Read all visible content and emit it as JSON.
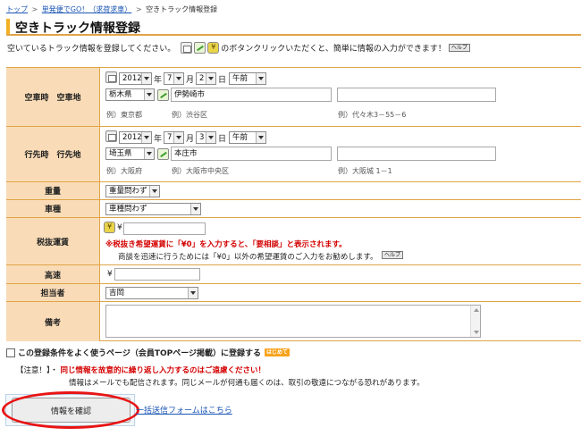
{
  "breadcrumb": {
    "home": "トップ",
    "parent": "単発便でGO！（求荷求車）",
    "current": "空きトラック情報登録",
    "sep": ">"
  },
  "page": {
    "title": "空きトラック情報登録",
    "intro_pre": "空いているトラック情報を登録してください。",
    "intro_post": "のボタンクリックいただくと、簡単に情報の入力ができます！",
    "help_label": "ヘルプ"
  },
  "departure": {
    "label": "空車時　空車地",
    "year": "2012",
    "year_unit": "年",
    "month": "7",
    "month_unit": "月",
    "day": "2",
    "day_unit": "日",
    "ampm": "午前",
    "pref": "栃木県",
    "city": "伊勢崎市",
    "address": "",
    "ex_pref": "例）東京都",
    "ex_city": "例）渋谷区",
    "ex_address": "例）代々木3－55－6"
  },
  "destination": {
    "label": "行先時　行先地",
    "year": "2012",
    "year_unit": "年",
    "month": "7",
    "month_unit": "月",
    "day": "3",
    "day_unit": "日",
    "ampm": "午前",
    "pref": "埼玉県",
    "city": "本庄市",
    "address": "",
    "ex_pref": "例）大阪府",
    "ex_city": "例）大阪市中央区",
    "ex_address": "例）大阪城 1－1"
  },
  "weight": {
    "label": "重量",
    "value": "重量問わず"
  },
  "vehicle": {
    "label": "車種",
    "value": "車種問わず"
  },
  "fare": {
    "label": "税抜運賃",
    "currency": "¥",
    "value": "",
    "warning": "※税抜き希望運賃に「¥0」を入力すると、「要相談」と表示されます。",
    "note": "商談を迅速に行うためには「¥0」以外の希望運賃のご入力をお勧めします。",
    "help_label": "ヘルプ"
  },
  "highway": {
    "label": "高速",
    "currency": "¥",
    "value": ""
  },
  "staff": {
    "label": "担当者",
    "value": "吉岡"
  },
  "remarks": {
    "label": "備考",
    "value": ""
  },
  "save_condition": {
    "label": "この登録条件をよく使うページ（会員TOPページ掲載）に登録する",
    "badge": "はじめて"
  },
  "caution": {
    "tag": "【注意！】・",
    "message": "同じ情報を故意的に繰り返し入力するのはご遠慮ください！",
    "detail": "情報はメールでも配信されます。同じメールが何通も届くのは、取引の敬遠につながる恐れがあります。"
  },
  "actions": {
    "confirm_label": "情報を確認",
    "back_link": "一括送信フォームはこちら"
  },
  "colors": {
    "label_bg": "#f9dcb7",
    "border": "#e0a447",
    "accent": "#f2b022",
    "warning": "#d40000",
    "link": "#1a55b5",
    "highlight_ring": "#e81414"
  }
}
